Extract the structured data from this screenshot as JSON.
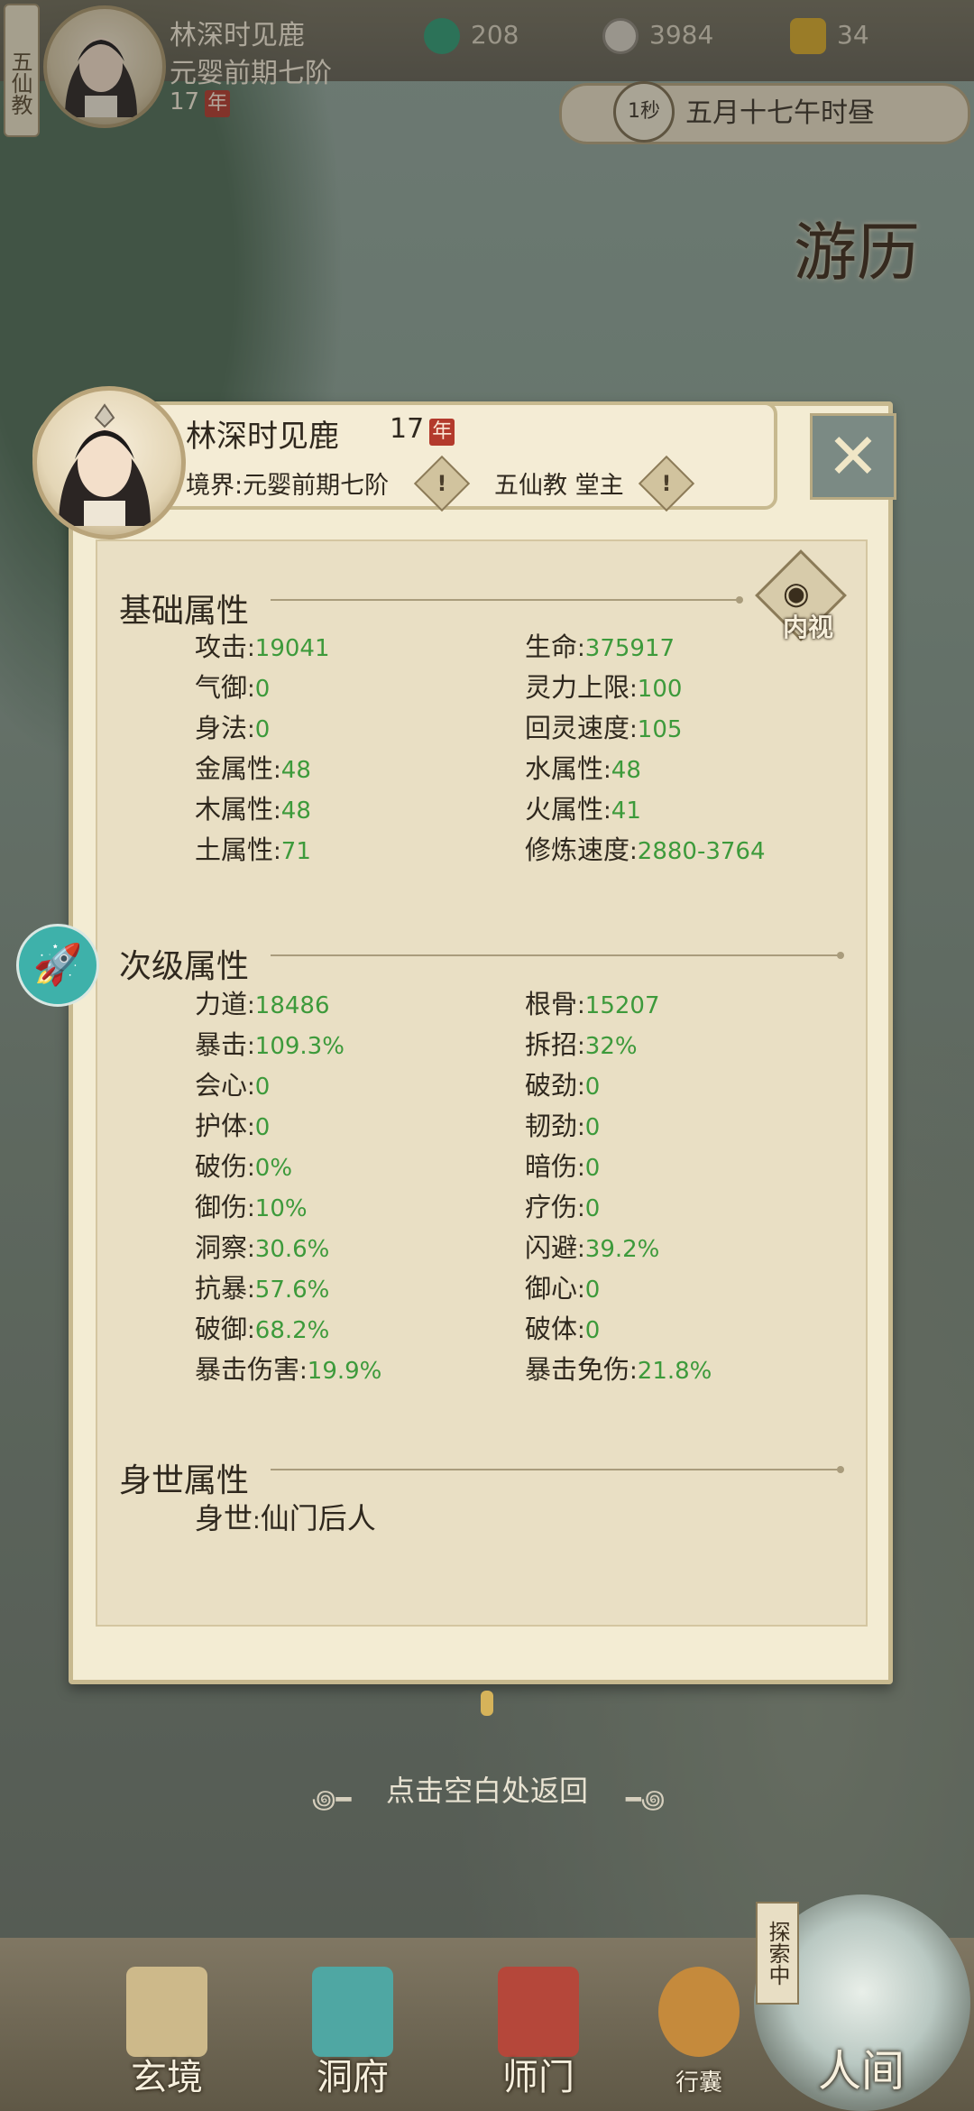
{
  "hud": {
    "sect_tab": "五仙教",
    "player_name": "林深时见鹿",
    "realm": "元婴前期七阶",
    "age": "17",
    "age_seal": "年",
    "resources": [
      {
        "icon": "jade-swirl-icon",
        "value": "208"
      },
      {
        "icon": "coin-icon",
        "value": "3984"
      },
      {
        "icon": "strength-icon",
        "value": "34"
      }
    ],
    "time_speed": "1秒",
    "game_time": "五月十七午时昼"
  },
  "side_button": "游历",
  "panel": {
    "name": "林深时见鹿",
    "age": "17",
    "age_seal": "年",
    "realm_line": "境界:元婴前期七阶",
    "sect_line": "五仙教 堂主",
    "close_symbol": "✕",
    "inner_view_label": "内视",
    "sections": {
      "basic": {
        "title": "基础属性",
        "left": [
          {
            "label": "攻击",
            "value": "19041"
          },
          {
            "label": "气御",
            "value": "0"
          },
          {
            "label": "身法",
            "value": "0"
          },
          {
            "label": "金属性",
            "value": "48"
          },
          {
            "label": "木属性",
            "value": "48"
          },
          {
            "label": "土属性",
            "value": "71"
          }
        ],
        "right": [
          {
            "label": "生命",
            "value": "375917"
          },
          {
            "label": "灵力上限",
            "value": "100"
          },
          {
            "label": "回灵速度",
            "value": "105"
          },
          {
            "label": "水属性",
            "value": "48"
          },
          {
            "label": "火属性",
            "value": "41"
          },
          {
            "label": "修炼速度",
            "value": "2880-3764"
          }
        ]
      },
      "secondary": {
        "title": "次级属性",
        "left": [
          {
            "label": "力道",
            "value": "18486"
          },
          {
            "label": "暴击",
            "value": "109.3%"
          },
          {
            "label": "会心",
            "value": "0"
          },
          {
            "label": "护体",
            "value": "0"
          },
          {
            "label": "破伤",
            "value": "0%"
          },
          {
            "label": "御伤",
            "value": "10%"
          },
          {
            "label": "洞察",
            "value": "30.6%"
          },
          {
            "label": "抗暴",
            "value": "57.6%"
          },
          {
            "label": "破御",
            "value": "68.2%"
          },
          {
            "label": "暴击伤害",
            "value": "19.9%"
          }
        ],
        "right": [
          {
            "label": "根骨",
            "value": "15207"
          },
          {
            "label": "拆招",
            "value": "32%"
          },
          {
            "label": "破劲",
            "value": "0"
          },
          {
            "label": "韧劲",
            "value": "0"
          },
          {
            "label": "暗伤",
            "value": "0"
          },
          {
            "label": "疗伤",
            "value": "0"
          },
          {
            "label": "闪避",
            "value": "39.2%"
          },
          {
            "label": "御心",
            "value": "0"
          },
          {
            "label": "破体",
            "value": "0"
          },
          {
            "label": "暴击免伤",
            "value": "21.8%"
          }
        ]
      },
      "background": {
        "title": "身世属性",
        "label": "身世",
        "value": "仙门后人"
      }
    }
  },
  "return_hint": "点击空白处返回",
  "bottom_nav": [
    {
      "label": "玄境"
    },
    {
      "label": "洞府"
    },
    {
      "label": "师门"
    },
    {
      "label": "行囊"
    }
  ],
  "renjian": {
    "label": "人间",
    "explore": "探索中"
  },
  "colors": {
    "value_green": "#3d9a3b",
    "seal_red": "#b33a2c",
    "rocket_teal": "#3eb1aa"
  }
}
